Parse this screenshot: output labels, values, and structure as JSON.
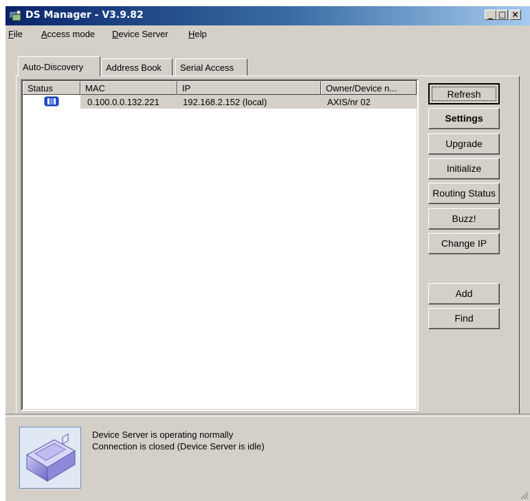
{
  "window": {
    "title": "DS Manager - V3.9.82",
    "controls": {
      "minimize": "_",
      "maximize": "□",
      "close": "×"
    }
  },
  "menu": [
    {
      "label": "File",
      "underline": "F",
      "rest": "ile"
    },
    {
      "label": "Access mode",
      "underline": "A",
      "rest": "ccess mode"
    },
    {
      "label": "Device Server",
      "underline": "D",
      "rest": "evice Server"
    },
    {
      "label": "Help",
      "underline": "H",
      "rest": "elp"
    }
  ],
  "tabs": [
    {
      "label": "Auto-Discovery",
      "active": true
    },
    {
      "label": "Address Book",
      "active": false
    },
    {
      "label": "Serial Access",
      "active": false
    }
  ],
  "table": {
    "columns": [
      "Status",
      "MAC",
      "IP",
      "Owner/Device n..."
    ],
    "rows": [
      {
        "status_icon": "device-online-icon",
        "mac": "0.100.0.0.132.221",
        "ip": "192.168.2.152 (local)",
        "owner": "AXIS/nr 02",
        "selected": true
      }
    ]
  },
  "buttons": {
    "refresh": "Refresh",
    "settings": "Settings",
    "upgrade": "Upgrade",
    "initialize": "Initialize",
    "routing_status": "Routing Status",
    "buzz": "Buzz!",
    "change_ip": "Change IP",
    "add": "Add",
    "find": "Find"
  },
  "status": {
    "line1": "Device Server is operating normally",
    "line2": "Connection is closed (Device Server is idle)",
    "image_icon": "device-server-icon"
  },
  "colors": {
    "titlebar_start": "#0a246a",
    "titlebar_end": "#a6caf0",
    "face": "#d4d0c8",
    "icon_blue": "#1f4fd1"
  }
}
